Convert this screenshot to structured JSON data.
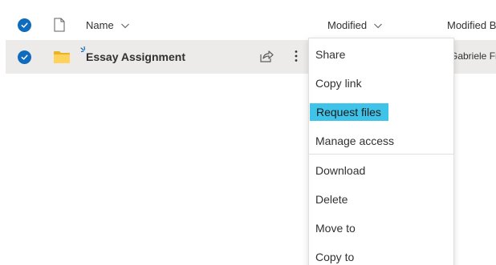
{
  "header": {
    "columns": [
      {
        "label": "Name"
      },
      {
        "label": "Modified"
      },
      {
        "label": "Modified By"
      }
    ]
  },
  "row": {
    "name": "Essay Assignment",
    "modified_by": "Gabriele Fra"
  },
  "menu": {
    "items": [
      {
        "label": "Share"
      },
      {
        "label": "Copy link"
      },
      {
        "label": "Request files"
      },
      {
        "label": "Manage access"
      },
      {
        "label": "Download"
      },
      {
        "label": "Delete"
      },
      {
        "label": "Move to"
      },
      {
        "label": "Copy to"
      }
    ],
    "highlighted": "Request files"
  },
  "icons": {
    "header_check": "checkmark-circle-icon",
    "file_type": "document-icon",
    "folder": "folder-icon",
    "new_badge": "sparkle-icon",
    "share": "share-icon",
    "more": "more-vertical-icon",
    "sort": "chevron-down-icon"
  },
  "colors": {
    "accent": "#0f6cbd",
    "folder": "#ffd35b",
    "row_selected_bg": "#edebe9",
    "menu_highlight": "#3fc3e8"
  }
}
